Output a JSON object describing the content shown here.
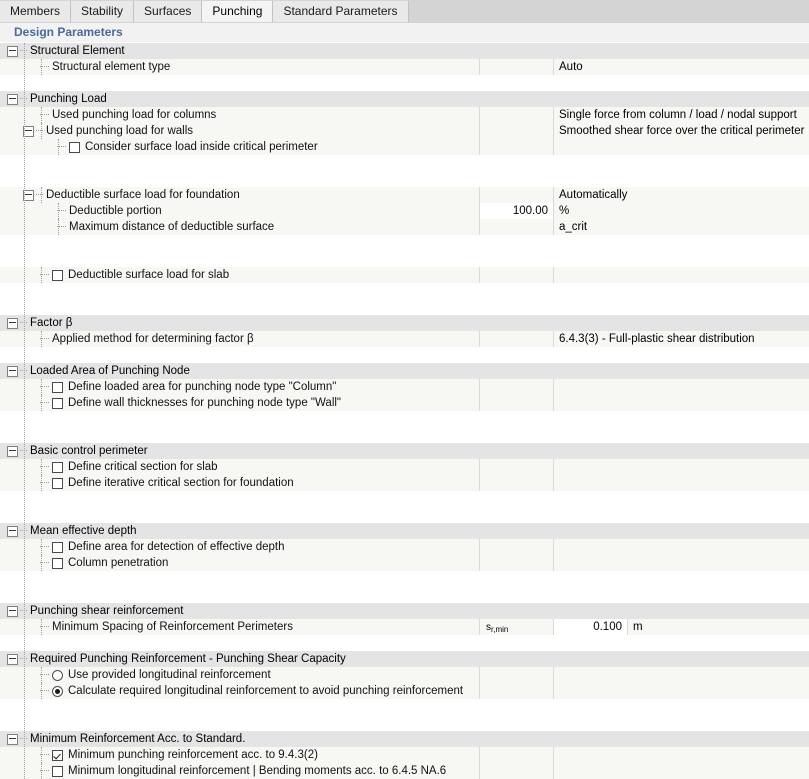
{
  "tabs": [
    {
      "label": "Members",
      "active": false
    },
    {
      "label": "Stability",
      "active": false
    },
    {
      "label": "Surfaces",
      "active": false
    },
    {
      "label": "Punching",
      "active": true
    },
    {
      "label": "Standard Parameters",
      "active": false
    }
  ],
  "section": {
    "title": "Design Parameters"
  },
  "groups": {
    "structural_element": "Structural Element",
    "punching_load": "Punching Load",
    "factor_beta": "Factor β",
    "loaded_area": "Loaded Area of Punching Node",
    "basic_control_perimeter": "Basic control perimeter",
    "mean_effective_depth": "Mean effective depth",
    "punching_shear_reinforcement": "Punching shear reinforcement",
    "required_punching_reinforcement": "Required Punching Reinforcement - Punching Shear Capacity",
    "minimum_reinforcement": "Minimum Reinforcement Acc. to Standard."
  },
  "rows": {
    "structural_element_type": {
      "label": "Structural element type",
      "value": "Auto"
    },
    "used_punching_load_columns": {
      "label": "Used punching load for columns",
      "value": "Single force from column / load / nodal support"
    },
    "used_punching_load_walls": {
      "label": "Used punching load for walls",
      "value": "Smoothed shear force over the critical perimeter"
    },
    "consider_surface_load": {
      "label": "Consider surface load inside critical perimeter",
      "checked": false
    },
    "deductible_surface_foundation": {
      "label": "Deductible surface load for foundation",
      "value": "Automatically"
    },
    "deductible_portion": {
      "label": "Deductible portion",
      "value": "100.00",
      "unit": "%"
    },
    "maximum_distance": {
      "label": "Maximum distance of deductible surface",
      "value": "a_crit"
    },
    "deductible_surface_slab": {
      "label": "Deductible surface load for slab",
      "checked": false
    },
    "applied_method_beta": {
      "label": "Applied method for determining factor β",
      "value": "6.4.3(3) - Full-plastic shear distribution"
    },
    "define_loaded_area_column": {
      "label": "Define loaded area for punching node type \"Column\"",
      "checked": false
    },
    "define_wall_thicknesses": {
      "label": "Define wall thicknesses for punching node type \"Wall\"",
      "checked": false
    },
    "define_critical_section_slab": {
      "label": "Define critical section for slab",
      "checked": false
    },
    "define_iterative_critical_section": {
      "label": "Define iterative critical section for foundation",
      "checked": false
    },
    "define_area_effective_depth": {
      "label": "Define area for detection of effective depth",
      "checked": false
    },
    "column_penetration": {
      "label": "Column penetration",
      "checked": false
    },
    "minimum_spacing": {
      "label": "Minimum Spacing of Reinforcement Perimeters",
      "symbol_base": "s",
      "symbol_sub": "r,min",
      "value": "0.100",
      "unit": "m"
    },
    "use_provided_longitudinal": {
      "label": "Use provided longitudinal reinforcement",
      "selected": false
    },
    "calculate_required_longitudinal": {
      "label": "Calculate required longitudinal reinforcement to avoid punching reinforcement",
      "selected": true
    },
    "minimum_punching_reinforcement": {
      "label": "Minimum punching reinforcement acc. to 9.4.3(2)",
      "checked": true
    },
    "minimum_longitudinal_reinforcement": {
      "label": "Minimum longitudinal reinforcement | Bending moments acc. to 6.4.5 NA.6",
      "checked": false
    }
  },
  "colors": {
    "tabbar_bg": "#d4d4d4",
    "tab_active_bg": "#f4f4f4",
    "section_title_color": "#4a6a9a",
    "group_row_bg": "#e4e4e4",
    "item_row_bg": "#f7f8f3"
  }
}
